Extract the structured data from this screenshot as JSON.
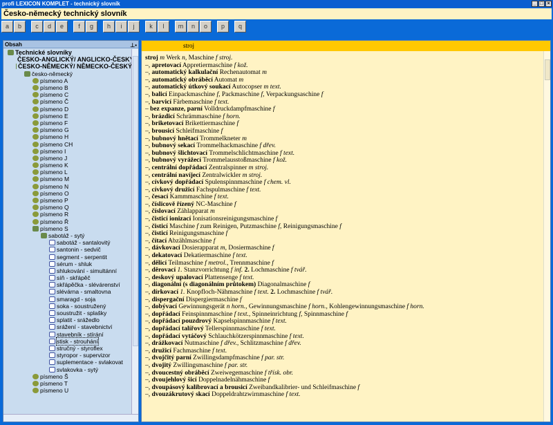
{
  "window": {
    "title": "profi LEXICON KOMPLET - technický slovník",
    "doc_title": "Česko-německý technický slovník"
  },
  "toolbar": [
    "a",
    "b",
    "c",
    "d",
    "e",
    "f",
    "g",
    "h",
    "i",
    "j",
    "k",
    "l",
    "m",
    "n",
    "o",
    "p",
    "q"
  ],
  "left": {
    "title": "Obsah",
    "tree": [
      {
        "t": "Technické slovníky",
        "d": 0,
        "ic": "root",
        "b": true
      },
      {
        "t": "ČESKO-ANGLICKÝ/ ANGLICKO-ČESKÝ",
        "d": 1,
        "ic": "pink",
        "b": true
      },
      {
        "t": "ČESKO-NĚMECKÝ/ NĚMECKO-ČESKÝ",
        "d": 1,
        "ic": "root",
        "b": true
      },
      {
        "t": "česko-německý",
        "d": 2,
        "ic": "root"
      },
      {
        "t": "písmeno A",
        "d": 3,
        "ic": "folder"
      },
      {
        "t": "písmeno B",
        "d": 3,
        "ic": "folder"
      },
      {
        "t": "písmeno C",
        "d": 3,
        "ic": "folder"
      },
      {
        "t": "písmeno Č",
        "d": 3,
        "ic": "folder"
      },
      {
        "t": "písmeno D",
        "d": 3,
        "ic": "folder"
      },
      {
        "t": "písmeno E",
        "d": 3,
        "ic": "folder"
      },
      {
        "t": "písmeno F",
        "d": 3,
        "ic": "folder"
      },
      {
        "t": "písmeno G",
        "d": 3,
        "ic": "folder"
      },
      {
        "t": "písmeno H",
        "d": 3,
        "ic": "folder"
      },
      {
        "t": "písmeno CH",
        "d": 3,
        "ic": "folder"
      },
      {
        "t": "písmeno I",
        "d": 3,
        "ic": "folder"
      },
      {
        "t": "písmeno J",
        "d": 3,
        "ic": "folder"
      },
      {
        "t": "písmeno K",
        "d": 3,
        "ic": "folder"
      },
      {
        "t": "písmeno L",
        "d": 3,
        "ic": "folder"
      },
      {
        "t": "písmeno M",
        "d": 3,
        "ic": "folder"
      },
      {
        "t": "písmeno N",
        "d": 3,
        "ic": "folder"
      },
      {
        "t": "písmeno O",
        "d": 3,
        "ic": "folder"
      },
      {
        "t": "písmeno P",
        "d": 3,
        "ic": "folder"
      },
      {
        "t": "písmeno Q",
        "d": 3,
        "ic": "folder"
      },
      {
        "t": "písmeno R",
        "d": 3,
        "ic": "folder"
      },
      {
        "t": "písmeno Ř",
        "d": 3,
        "ic": "folder"
      },
      {
        "t": "písmeno S",
        "d": 3,
        "ic": "root"
      },
      {
        "t": "sabotáž - sytý",
        "d": 4,
        "ic": "root"
      },
      {
        "t": "sabotáž - santalovitý",
        "d": 5,
        "ic": "doc"
      },
      {
        "t": "santonin - sedvič",
        "d": 5,
        "ic": "doc"
      },
      {
        "t": "segment - serpentit",
        "d": 5,
        "ic": "doc"
      },
      {
        "t": "sérum - shluk",
        "d": 5,
        "ic": "doc"
      },
      {
        "t": "shlukování - simultánní",
        "d": 5,
        "ic": "doc"
      },
      {
        "t": "síň - skřápěč",
        "d": 5,
        "ic": "doc"
      },
      {
        "t": "skřápěčka - slévárenství",
        "d": 5,
        "ic": "doc"
      },
      {
        "t": "slévárna - smaltovna",
        "d": 5,
        "ic": "doc"
      },
      {
        "t": "smaragd - soja",
        "d": 5,
        "ic": "doc"
      },
      {
        "t": "soka - soustružený",
        "d": 5,
        "ic": "doc"
      },
      {
        "t": "soustružit - splašky",
        "d": 5,
        "ic": "doc"
      },
      {
        "t": "splatit - srážedlo",
        "d": 5,
        "ic": "doc"
      },
      {
        "t": "srážení - stavebnictví",
        "d": 5,
        "ic": "doc"
      },
      {
        "t": "stavebník - stírání",
        "d": 5,
        "ic": "doc"
      },
      {
        "t": "stisk - strouhání",
        "d": 5,
        "ic": "doc",
        "sel": true
      },
      {
        "t": "stručný - styroflex",
        "d": 5,
        "ic": "doc"
      },
      {
        "t": "styropor - supervizor",
        "d": 5,
        "ic": "doc"
      },
      {
        "t": "suplementace - svlakovat",
        "d": 5,
        "ic": "doc"
      },
      {
        "t": "svlakovka - sytý",
        "d": 5,
        "ic": "doc"
      },
      {
        "t": "písmeno Š",
        "d": 3,
        "ic": "folder"
      },
      {
        "t": "písmeno T",
        "d": 3,
        "ic": "folder"
      },
      {
        "t": "písmeno U",
        "d": 3,
        "ic": "folder"
      }
    ]
  },
  "right": {
    "header": "stroj",
    "entries": [
      [
        [
          "b",
          "stroj"
        ],
        [
          "i",
          " m "
        ],
        [
          "",
          "Werk "
        ],
        [
          "i",
          "n"
        ],
        [
          "",
          ", Maschine "
        ],
        [
          "i",
          "f stroj."
        ]
      ],
      [
        [
          "",
          "–, "
        ],
        [
          "b",
          "apretovací"
        ],
        [
          "",
          " Appretiermaschine "
        ],
        [
          "i",
          "f kož."
        ]
      ],
      [
        [
          "",
          "–, "
        ],
        [
          "b",
          "automatický kalkulační"
        ],
        [
          "",
          " Rechenautomat "
        ],
        [
          "i",
          "m"
        ]
      ],
      [
        [
          "",
          "–, "
        ],
        [
          "b",
          "automatický obráběcí"
        ],
        [
          "",
          " Automat "
        ],
        [
          "i",
          "m"
        ]
      ],
      [
        [
          "",
          "–, "
        ],
        [
          "b",
          "automatický útkový soukací"
        ],
        [
          "",
          " Autocopser "
        ],
        [
          "i",
          "m text."
        ]
      ],
      [
        [
          "",
          "–, "
        ],
        [
          "b",
          "balicí"
        ],
        [
          "",
          " Einpackmaschine "
        ],
        [
          "i",
          "f"
        ],
        [
          "",
          ", Packmaschine "
        ],
        [
          "i",
          "f"
        ],
        [
          "",
          ", Verpackungsaschine "
        ],
        [
          "i",
          "f"
        ]
      ],
      [
        [
          "",
          "–, "
        ],
        [
          "b",
          "barvicí"
        ],
        [
          "",
          " Färbemaschine "
        ],
        [
          "i",
          "f text."
        ]
      ],
      [
        [
          "",
          "– "
        ],
        [
          "b",
          "bez expanze, parní"
        ],
        [
          "",
          " Volldruckdampfmaschine "
        ],
        [
          "i",
          "f"
        ]
      ],
      [
        [
          "",
          "–, "
        ],
        [
          "b",
          "brázdicí"
        ],
        [
          "",
          " Schrämmaschine "
        ],
        [
          "i",
          "f horn."
        ]
      ],
      [
        [
          "",
          "–, "
        ],
        [
          "b",
          "briketovací"
        ],
        [
          "",
          " Brikettiermaschine "
        ],
        [
          "i",
          "f"
        ]
      ],
      [
        [
          "",
          "–, "
        ],
        [
          "b",
          "brousicí"
        ],
        [
          "",
          " Schleifmaschine "
        ],
        [
          "i",
          "f"
        ]
      ],
      [
        [
          "",
          "–, "
        ],
        [
          "b",
          "bubnový hnětací"
        ],
        [
          "",
          " Trommelkneter "
        ],
        [
          "i",
          "m"
        ]
      ],
      [
        [
          "",
          "–, "
        ],
        [
          "b",
          "bubnový sekací"
        ],
        [
          "",
          " Trommelhackmaschine "
        ],
        [
          "i",
          "f dřev."
        ]
      ],
      [
        [
          "",
          "–, "
        ],
        [
          "b",
          "bubnový šlichtovací"
        ],
        [
          "",
          " Trommelschlichtmaschine "
        ],
        [
          "i",
          "f text."
        ]
      ],
      [
        [
          "",
          "–, "
        ],
        [
          "b",
          "bubnový vyrážecí"
        ],
        [
          "",
          " Trommelausstoßmaschine "
        ],
        [
          "i",
          "f kož."
        ]
      ],
      [
        [
          "",
          "–, "
        ],
        [
          "b",
          "centrální dopřádací"
        ],
        [
          "",
          " Zentralspinner "
        ],
        [
          "i",
          "m stroj."
        ]
      ],
      [
        [
          "",
          "–, "
        ],
        [
          "b",
          "centrální navíjecí"
        ],
        [
          "",
          " Zentralwickler "
        ],
        [
          "i",
          "m stroj."
        ]
      ],
      [
        [
          "",
          "–, "
        ],
        [
          "b",
          "cívkový dopřádací"
        ],
        [
          "",
          " Spulenspinnmaschine "
        ],
        [
          "i",
          "f chem. vl."
        ]
      ],
      [
        [
          "",
          "–, "
        ],
        [
          "b",
          "cívkový družicí"
        ],
        [
          "",
          " Fachspulmaschine "
        ],
        [
          "i",
          "f text."
        ]
      ],
      [
        [
          "",
          "–, "
        ],
        [
          "b",
          "česací"
        ],
        [
          "",
          " Kammmaschine "
        ],
        [
          "i",
          "f text."
        ]
      ],
      [
        [
          "",
          "–, "
        ],
        [
          "b",
          "číslicově řízený"
        ],
        [
          "",
          " NC-Maschine "
        ],
        [
          "i",
          "f"
        ]
      ],
      [
        [
          "",
          "–, "
        ],
        [
          "b",
          "číslovací"
        ],
        [
          "",
          " Zählapparat "
        ],
        [
          "i",
          "m"
        ]
      ],
      [
        [
          "",
          "–, "
        ],
        [
          "b",
          "čisticí ionizací"
        ],
        [
          "",
          " Ionisationsreinigungsmaschine "
        ],
        [
          "i",
          "f"
        ]
      ],
      [
        [
          "",
          "–, "
        ],
        [
          "b",
          "čisticí"
        ],
        [
          "",
          " Maschine "
        ],
        [
          "i",
          "f"
        ],
        [
          "",
          " zum Reinigen, Putzmaschine "
        ],
        [
          "i",
          "f"
        ],
        [
          "",
          ", Reinigungsmaschine "
        ],
        [
          "i",
          "f"
        ]
      ],
      [
        [
          "",
          "–, "
        ],
        [
          "b",
          "čisticí"
        ],
        [
          "",
          " Reinigungsmaschine "
        ],
        [
          "i",
          "f"
        ]
      ],
      [
        [
          "",
          "–, "
        ],
        [
          "b",
          "čítací"
        ],
        [
          "",
          " Abzählmaschine "
        ],
        [
          "i",
          "f"
        ]
      ],
      [
        [
          "",
          "–, "
        ],
        [
          "b",
          "dávkovací"
        ],
        [
          "",
          " Dosierapparat "
        ],
        [
          "i",
          "m"
        ],
        [
          "",
          ", Dosiermaschine "
        ],
        [
          "i",
          "f"
        ]
      ],
      [
        [
          "",
          "–, "
        ],
        [
          "b",
          "dekatovací"
        ],
        [
          "",
          " Dekatiermaschine "
        ],
        [
          "i",
          "f text."
        ]
      ],
      [
        [
          "",
          "–, "
        ],
        [
          "b",
          "dělicí"
        ],
        [
          "",
          " Teilmaschine "
        ],
        [
          "i",
          "f metrol."
        ],
        [
          "",
          ", Trennmaschine "
        ],
        [
          "i",
          "f"
        ]
      ],
      [
        [
          "",
          "–, "
        ],
        [
          "b",
          "děrovací"
        ],
        [
          "i",
          " 1. "
        ],
        [
          "",
          "Stanzvorrichtung "
        ],
        [
          "i",
          "f inf."
        ],
        [
          "b",
          " 2. "
        ],
        [
          "",
          "Lochmaschine "
        ],
        [
          "i",
          "f tvář."
        ]
      ],
      [
        [
          "",
          "–, "
        ],
        [
          "b",
          "deskový upalovací"
        ],
        [
          "",
          " Plattensenge "
        ],
        [
          "i",
          "f text."
        ]
      ],
      [
        [
          "",
          "–, "
        ],
        [
          "b",
          "diagonální (s diagonálním průtokem)"
        ],
        [
          "",
          " Diagonalmaschine "
        ],
        [
          "i",
          "f"
        ]
      ],
      [
        [
          "",
          "–, "
        ],
        [
          "b",
          "dírkovací"
        ],
        [
          "i",
          " 1. "
        ],
        [
          "",
          "Knopfloch-Nähmaschine "
        ],
        [
          "i",
          "f text."
        ],
        [
          "b",
          " 2. "
        ],
        [
          "",
          "Lochmaschine "
        ],
        [
          "i",
          "f tvář."
        ]
      ],
      [
        [
          "",
          "–, "
        ],
        [
          "b",
          "dispergační"
        ],
        [
          "",
          " Dispergiermaschine "
        ],
        [
          "i",
          "f"
        ]
      ],
      [
        [
          "",
          "–, "
        ],
        [
          "b",
          "dobývací"
        ],
        [
          "",
          " Gewinnungsgerät "
        ],
        [
          "i",
          "n horn."
        ],
        [
          "",
          ", Gewinnungsmaschine "
        ],
        [
          "i",
          "f horn."
        ],
        [
          "",
          ", Kohlengewinnungsmaschine "
        ],
        [
          "i",
          "f horn."
        ]
      ],
      [
        [
          "",
          "–, "
        ],
        [
          "b",
          "dopřádací"
        ],
        [
          "",
          " Feinspinnmaschine "
        ],
        [
          "i",
          "f text."
        ],
        [
          "",
          ", Spinneinrichtung "
        ],
        [
          "i",
          "f"
        ],
        [
          "",
          ", Spinnmaschine "
        ],
        [
          "i",
          "f"
        ]
      ],
      [
        [
          "",
          "–, "
        ],
        [
          "b",
          "dopřádací pouzdrový"
        ],
        [
          "",
          " Kapselspinnmaschine "
        ],
        [
          "i",
          "f text."
        ]
      ],
      [
        [
          "",
          "–, "
        ],
        [
          "b",
          "dopřádací talířový"
        ],
        [
          "",
          " Tellerspinnmaschine "
        ],
        [
          "i",
          "f text."
        ]
      ],
      [
        [
          "",
          "–, "
        ],
        [
          "b",
          "dopřádací vytáčový"
        ],
        [
          "",
          " Schlauchkötzerspinnmaschine "
        ],
        [
          "i",
          "f text."
        ]
      ],
      [
        [
          "",
          "–, "
        ],
        [
          "b",
          "drážkovací"
        ],
        [
          "",
          " Nutmaschine "
        ],
        [
          "i",
          "f dřev."
        ],
        [
          "",
          ", Schlitzmaschine "
        ],
        [
          "i",
          "f dřev."
        ]
      ],
      [
        [
          "",
          "–, "
        ],
        [
          "b",
          "družicí"
        ],
        [
          "",
          " Fachmaschine "
        ],
        [
          "i",
          "f text."
        ]
      ],
      [
        [
          "",
          "–, "
        ],
        [
          "b",
          "dvojčitý parní"
        ],
        [
          "",
          " Zwillingsdampfmaschine "
        ],
        [
          "i",
          "f par. str."
        ]
      ],
      [
        [
          "",
          "–, "
        ],
        [
          "b",
          "dvojitý"
        ],
        [
          "",
          " Zwillingsmaschine "
        ],
        [
          "i",
          "f par. str."
        ]
      ],
      [
        [
          "",
          "–, "
        ],
        [
          "b",
          "dvoucestný obráběcí"
        ],
        [
          "",
          " Zweiwegemaschine "
        ],
        [
          "i",
          "f třísk. obr."
        ]
      ],
      [
        [
          "",
          "–, "
        ],
        [
          "b",
          "dvoujehlový šicí"
        ],
        [
          "",
          " Doppelnadelnähmaschine "
        ],
        [
          "i",
          "f"
        ]
      ],
      [
        [
          "",
          "–, "
        ],
        [
          "b",
          "dvoupásový kalibrovací a brousicí"
        ],
        [
          "",
          " Zweibandkalibrier- und Schleifmaschine "
        ],
        [
          "i",
          "f"
        ]
      ],
      [
        [
          "",
          "–, "
        ],
        [
          "b",
          "dvouzákrutový skací"
        ],
        [
          "",
          " Doppeldrahtzwirnmaschine "
        ],
        [
          "i",
          "f text."
        ]
      ]
    ]
  }
}
